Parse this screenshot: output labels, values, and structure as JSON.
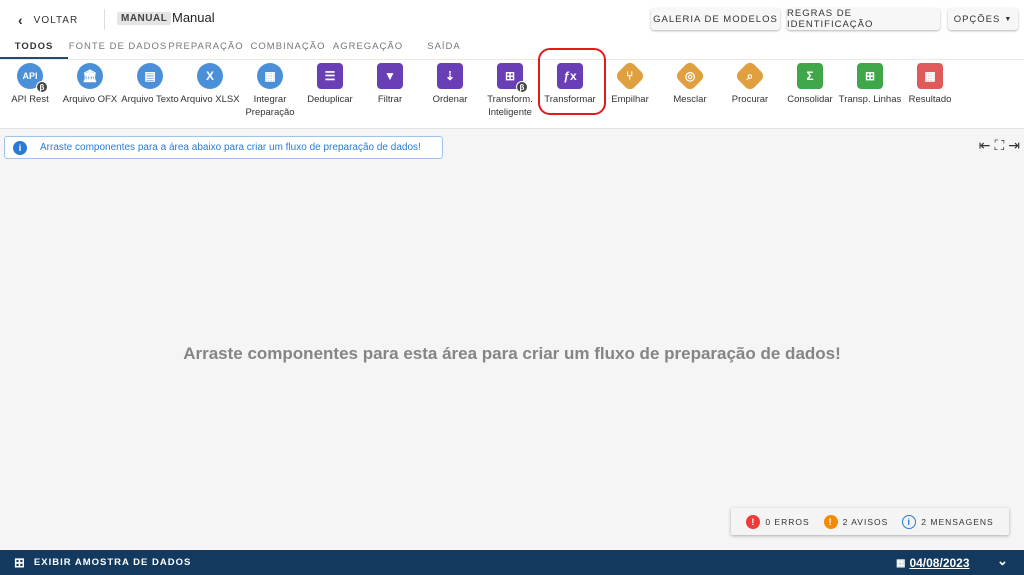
{
  "header": {
    "back_label": "VOLTAR",
    "mode_badge": "MANUAL",
    "title": "Manual",
    "gallery_button": "GALERIA DE MODELOS",
    "rules_button": "REGRAS DE IDENTIFICAÇÃO",
    "options_button": "OPÇÕES"
  },
  "tabs": [
    "TODOS",
    "FONTE DE DADOS",
    "PREPARAÇÃO",
    "COMBINAÇÃO",
    "AGREGAÇÃO",
    "SAÍDA"
  ],
  "components": [
    {
      "label": "API Rest",
      "glyph": "API",
      "icon": "api-icon",
      "color": "#4a90d9",
      "beta": "β"
    },
    {
      "label": "Arquivo OFX",
      "glyph": "🏛",
      "icon": "bank-icon",
      "color": "#4a90d9"
    },
    {
      "label": "Arquivo Texto",
      "glyph": "▤",
      "icon": "text-file-icon",
      "color": "#4a90d9"
    },
    {
      "label": "Arquivo XLSX",
      "glyph": "X",
      "icon": "xlsx-file-icon",
      "color": "#4a90d9"
    },
    {
      "label": "Integrar",
      "label2": "Preparação",
      "glyph": "▦",
      "icon": "grid-icon",
      "color": "#4a90d9"
    },
    {
      "label": "Deduplicar",
      "glyph": "☰",
      "icon": "list-icon",
      "color": "#6a3fb5"
    },
    {
      "label": "Filtrar",
      "glyph": "▼",
      "icon": "filter-icon",
      "color": "#6a3fb5"
    },
    {
      "label": "Ordenar",
      "glyph": "⇣",
      "icon": "sort-icon",
      "color": "#6a3fb5"
    },
    {
      "label": "Transform.",
      "label2": "Inteligente",
      "glyph": "⊞",
      "icon": "smart-transform-icon",
      "color": "#6a3fb5",
      "beta": "β"
    },
    {
      "label": "Transformar",
      "glyph": "ƒx",
      "icon": "function-icon",
      "color": "#6a3fb5"
    },
    {
      "label": "Empilhar",
      "glyph": "⑂",
      "icon": "stack-icon",
      "color": "#e0a040"
    },
    {
      "label": "Mesclar",
      "glyph": "◎",
      "icon": "merge-icon",
      "color": "#e0a040"
    },
    {
      "label": "Procurar",
      "glyph": "⌕",
      "icon": "lookup-icon",
      "color": "#e0a040"
    },
    {
      "label": "Consolidar",
      "glyph": "Σ",
      "icon": "sigma-icon",
      "color": "#3fa64a"
    },
    {
      "label": "Transp. Linhas",
      "glyph": "⊞",
      "icon": "transpose-icon",
      "color": "#3fa64a"
    },
    {
      "label": "Resultado",
      "glyph": "▦",
      "icon": "result-table-icon",
      "color": "#e05a5a"
    }
  ],
  "info_banner": "Arraste componentes para a área abaixo para criar um fluxo de preparação de dados!",
  "canvas_empty": "Arraste componentes para esta área para criar um fluxo de preparação de dados!",
  "status": {
    "errors": "0 ERROS",
    "warnings": "2 AVISOS",
    "messages": "2 MENSAGENS",
    "error_color": "#f03a3a",
    "warning_color": "#f58a07",
    "message_color": "#2a7ad6"
  },
  "footer": {
    "sample_label": "EXIBIR AMOSTRA DE DADOS",
    "date": "04/08/2023"
  }
}
